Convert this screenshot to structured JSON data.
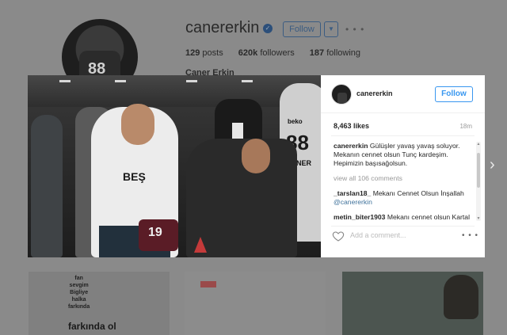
{
  "profile": {
    "username": "canererkin",
    "full_name": "Caner Erkin",
    "follow_label": "Follow",
    "dropdown_icon": "▼",
    "more_icon": "• • •",
    "stats": [
      {
        "value": "129",
        "label": "posts"
      },
      {
        "value": "620k",
        "label": "followers"
      },
      {
        "value": "187",
        "label": "following"
      }
    ],
    "avatar_number": "88"
  },
  "background_tiles": {
    "tile1_words": [
      "fan",
      "sevgim",
      "Bigliye",
      "halka",
      "farkında"
    ],
    "tile1_big": "farkında ol"
  },
  "post_photo": {
    "mannequin_brand": "beko",
    "mannequin_number": "88",
    "mannequin_name": "CANER",
    "shirt_print": "BEŞ",
    "red_jersey_number": "19"
  },
  "post": {
    "username": "canererkin",
    "follow_label": "Follow",
    "likes": "8,463 likes",
    "age": "18m",
    "caption_user": "canererkin",
    "caption_text": " Gülüşler yavaş yavaş soluyor. Mekanın cennet olsun Tunç kardeşim. Hepimizin başısağolsun.",
    "view_all": "view all 106 comments",
    "comments": [
      {
        "user": "_tarslan18_",
        "text": " Mekanı Cennet Olsun İnşallah ",
        "mention": "@canererkin"
      },
      {
        "user": "metin_biter1903",
        "text": " Mekanı cennet olsun Kartal kardeşimin acısına taziyle",
        "mention": ""
      }
    ],
    "add_comment_placeholder": "Add a comment...",
    "more_icon": "• • •"
  },
  "navigation": {
    "next_arrow": "›"
  },
  "colors": {
    "accent": "#3897f0",
    "overlay": "#7a7a7a",
    "mention": "#3f729b"
  }
}
